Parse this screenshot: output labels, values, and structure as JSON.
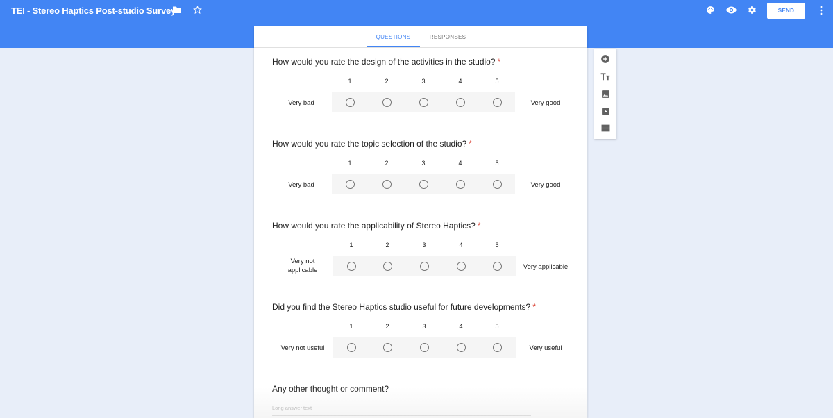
{
  "header": {
    "title": "TEI - Stereo Haptics Post-studio Survey",
    "send_label": "SEND",
    "icons": [
      "folder-icon",
      "star-icon",
      "palette-icon",
      "eye-icon",
      "gear-icon",
      "more-vert-icon"
    ],
    "brand_color": "#4285f4"
  },
  "tabs": {
    "questions": "QUESTIONS",
    "responses": "RESPONSES",
    "active": "QUESTIONS"
  },
  "questions": [
    {
      "title": "How would you rate the design of the activities in the studio?",
      "required_mark": "*",
      "scale": [
        "1",
        "2",
        "3",
        "4",
        "5"
      ],
      "low_label": "Very bad",
      "high_label": "Very good"
    },
    {
      "title": "How would you rate the topic selection of the studio?",
      "required_mark": "*",
      "scale": [
        "1",
        "2",
        "3",
        "4",
        "5"
      ],
      "low_label": "Very bad",
      "high_label": "Very good"
    },
    {
      "title": "How would you rate the applicability of Stereo Haptics?",
      "required_mark": "*",
      "scale": [
        "1",
        "2",
        "3",
        "4",
        "5"
      ],
      "low_label": "Very not applicable",
      "high_label": "Very applicable"
    },
    {
      "title": "Did you find the Stereo Haptics studio useful for future developments?",
      "required_mark": "*",
      "scale": [
        "1",
        "2",
        "3",
        "4",
        "5"
      ],
      "low_label": "Very not useful",
      "high_label": "Very useful"
    }
  ],
  "open_question": {
    "title": "Any other thought or comment?",
    "placeholder": "Long answer text"
  },
  "side_toolbar": [
    "add-question-icon",
    "title-text-icon",
    "image-icon",
    "video-icon",
    "section-icon"
  ],
  "colors": {
    "required": "#db4437",
    "radio": "#757575",
    "page_background": "#e8eef9"
  }
}
